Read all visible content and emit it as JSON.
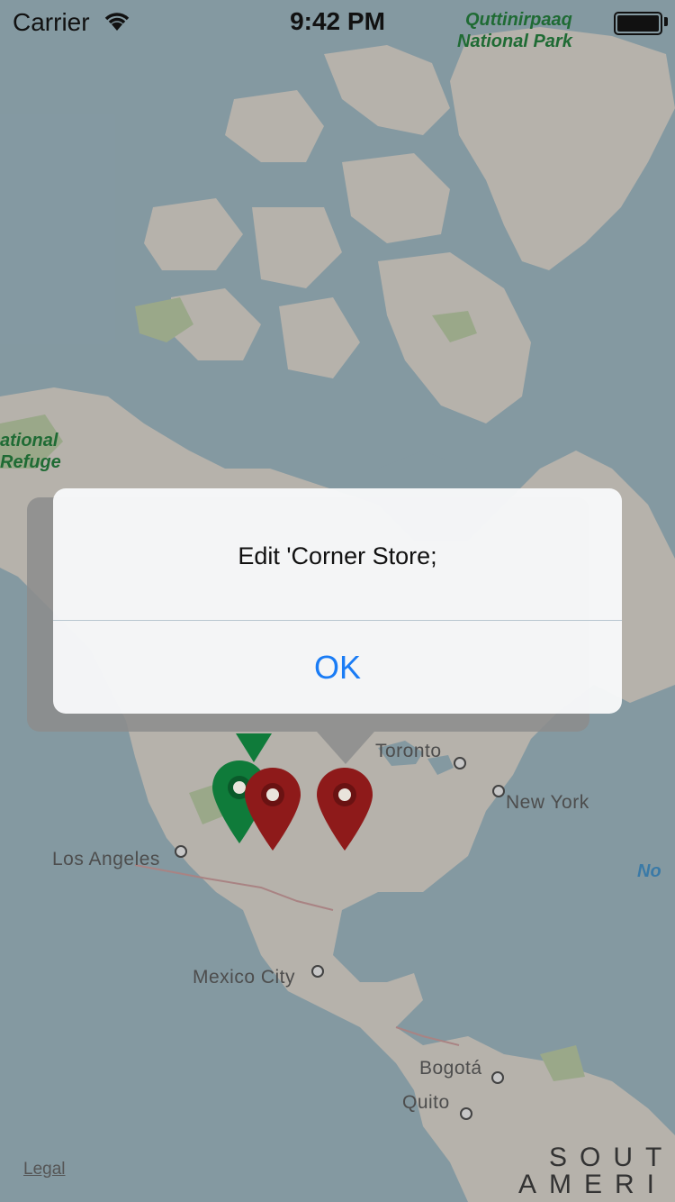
{
  "status_bar": {
    "carrier": "Carrier",
    "time": "9:42 PM"
  },
  "map": {
    "parks": [
      {
        "name": "Quttinirpaaq",
        "name2": "National Park"
      },
      {
        "name": "ational",
        "name2": "Refuge"
      }
    ],
    "cities": [
      "Toronto",
      "New York",
      "Los Angeles",
      "Mexico City",
      "Bogotá",
      "Quito"
    ],
    "ocean_label": "No",
    "continent_line1": "SOUT",
    "continent_line2": "AMERI",
    "legal": "Legal"
  },
  "pins": [
    {
      "name": "green-pin",
      "color": "#0f7b3a"
    },
    {
      "name": "red-pin-1",
      "color": "#8e1a1a"
    },
    {
      "name": "red-pin-2",
      "color": "#8e1a1a"
    }
  ],
  "alert": {
    "message": "Edit 'Corner Store;",
    "ok_label": "OK"
  }
}
